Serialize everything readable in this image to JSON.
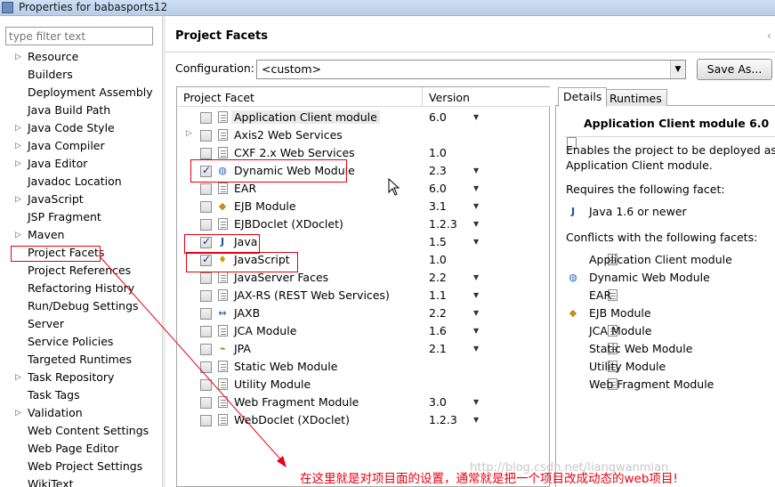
{
  "window": {
    "title": "Properties for babasports12"
  },
  "left_panel": {
    "filter_placeholder": "type filter text",
    "items": [
      {
        "label": "Resource",
        "expandable": true
      },
      {
        "label": "Builders",
        "expandable": false
      },
      {
        "label": "Deployment Assembly",
        "expandable": false
      },
      {
        "label": "Java Build Path",
        "expandable": false
      },
      {
        "label": "Java Code Style",
        "expandable": true
      },
      {
        "label": "Java Compiler",
        "expandable": true
      },
      {
        "label": "Java Editor",
        "expandable": true
      },
      {
        "label": "Javadoc Location",
        "expandable": false
      },
      {
        "label": "JavaScript",
        "expandable": true
      },
      {
        "label": "JSP Fragment",
        "expandable": false
      },
      {
        "label": "Maven",
        "expandable": true
      },
      {
        "label": "Project Facets",
        "expandable": false,
        "selected": true
      },
      {
        "label": "Project References",
        "expandable": false
      },
      {
        "label": "Refactoring History",
        "expandable": false
      },
      {
        "label": "Run/Debug Settings",
        "expandable": false
      },
      {
        "label": "Server",
        "expandable": false
      },
      {
        "label": "Service Policies",
        "expandable": false
      },
      {
        "label": "Targeted Runtimes",
        "expandable": false
      },
      {
        "label": "Task Repository",
        "expandable": true
      },
      {
        "label": "Task Tags",
        "expandable": false
      },
      {
        "label": "Validation",
        "expandable": true
      },
      {
        "label": "Web Content Settings",
        "expandable": false
      },
      {
        "label": "Web Page Editor",
        "expandable": false
      },
      {
        "label": "Web Project Settings",
        "expandable": false
      },
      {
        "label": "WikiText",
        "expandable": false
      }
    ]
  },
  "header": {
    "title": "Project Facets",
    "nav_icons": "‹"
  },
  "configuration": {
    "label": "Configuration:",
    "value": "<custom>",
    "save_as_label": "Save As..."
  },
  "facets_table": {
    "col_facet": "Project Facet",
    "col_version": "Version",
    "rows": [
      {
        "name": "Application Client module",
        "version": "6.0",
        "checked": false,
        "has_dropdown": true,
        "icon": "document-icon",
        "selected": true
      },
      {
        "name": "Axis2 Web Services",
        "version": "",
        "checked": false,
        "has_dropdown": false,
        "icon": "document-icon",
        "expander": true
      },
      {
        "name": "CXF 2.x Web Services",
        "version": "1.0",
        "checked": false,
        "has_dropdown": false,
        "icon": "document-icon"
      },
      {
        "name": "Dynamic Web Module",
        "version": "2.3",
        "checked": true,
        "has_dropdown": true,
        "icon": "globe-icon"
      },
      {
        "name": "EAR",
        "version": "6.0",
        "checked": false,
        "has_dropdown": true,
        "icon": "document-icon"
      },
      {
        "name": "EJB Module",
        "version": "3.1",
        "checked": false,
        "has_dropdown": true,
        "icon": "ejb-icon"
      },
      {
        "name": "EJBDoclet (XDoclet)",
        "version": "1.2.3",
        "checked": false,
        "has_dropdown": true,
        "icon": "document-icon"
      },
      {
        "name": "Java",
        "version": "1.5",
        "checked": true,
        "has_dropdown": true,
        "icon": "java-icon"
      },
      {
        "name": "JavaScript",
        "version": "1.0",
        "checked": true,
        "has_dropdown": false,
        "icon": "js-icon"
      },
      {
        "name": "JavaServer Faces",
        "version": "2.2",
        "checked": false,
        "has_dropdown": true,
        "icon": "document-icon"
      },
      {
        "name": "JAX-RS (REST Web Services)",
        "version": "1.1",
        "checked": false,
        "has_dropdown": true,
        "icon": "document-icon"
      },
      {
        "name": "JAXB",
        "version": "2.2",
        "checked": false,
        "has_dropdown": true,
        "icon": "jaxb-icon"
      },
      {
        "name": "JCA Module",
        "version": "1.6",
        "checked": false,
        "has_dropdown": true,
        "icon": "document-icon"
      },
      {
        "name": "JPA",
        "version": "2.1",
        "checked": false,
        "has_dropdown": true,
        "icon": "jpa-icon"
      },
      {
        "name": "Static Web Module",
        "version": "",
        "checked": false,
        "has_dropdown": false,
        "icon": "document-icon"
      },
      {
        "name": "Utility Module",
        "version": "",
        "checked": false,
        "has_dropdown": false,
        "icon": "document-icon"
      },
      {
        "name": "Web Fragment Module",
        "version": "3.0",
        "checked": false,
        "has_dropdown": true,
        "icon": "document-icon"
      },
      {
        "name": "WebDoclet (XDoclet)",
        "version": "1.2.3",
        "checked": false,
        "has_dropdown": true,
        "icon": "document-icon"
      }
    ]
  },
  "details": {
    "tab_details": "Details",
    "tab_runtimes": "Runtimes",
    "title": "Application Client module 6.0",
    "desc_line1": "Enables the project to be deployed as a",
    "desc_line2": "Application Client module.",
    "requires_label": "Requires the following facet:",
    "requires": [
      {
        "label": "Java 1.6 or newer",
        "icon": "java-icon"
      }
    ],
    "conflicts_label": "Conflicts with the following facets:",
    "conflicts": [
      {
        "label": "Application Client module",
        "icon": "document-icon"
      },
      {
        "label": "Dynamic Web Module",
        "icon": "globe-icon"
      },
      {
        "label": "EAR",
        "icon": "document-icon"
      },
      {
        "label": "EJB Module",
        "icon": "ejb-icon"
      },
      {
        "label": "JCA Module",
        "icon": "document-icon"
      },
      {
        "label": "Static Web Module",
        "icon": "document-icon"
      },
      {
        "label": "Utility Module",
        "icon": "document-icon"
      },
      {
        "label": "Web Fragment Module",
        "icon": "document-icon"
      }
    ]
  },
  "annotation": {
    "text": "在这里就是对项目面的设置，通常就是把一个项目改成动态的web项目!",
    "color": "#e60012"
  },
  "watermark": "http://blog.csdn.net/liangwanmian"
}
